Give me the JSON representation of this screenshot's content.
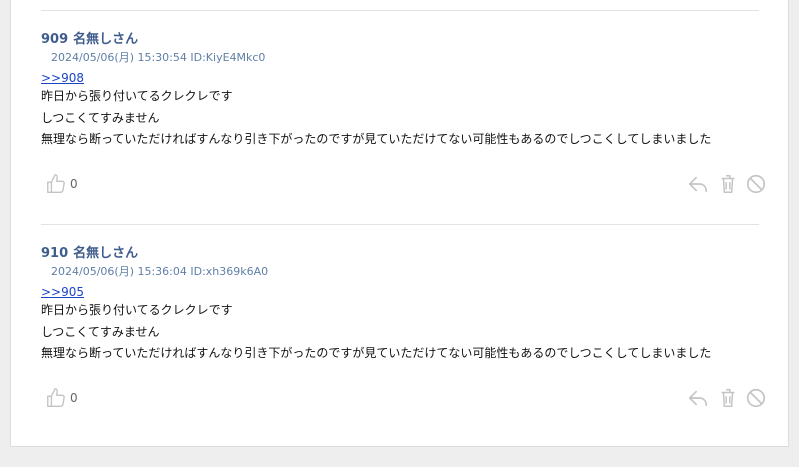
{
  "posts": [
    {
      "number": "909",
      "name": "名無しさん",
      "meta": "2024/05/06(月) 15:30:54 ID:KiyE4Mkc0",
      "anchor": ">>908",
      "lines": [
        "昨日から張り付いてるクレクレです",
        "しつこくてすみません",
        "無理なら断っていただければすんなり引き下がったのですが見ていただけてない可能性もあるのでしつこくしてしまいました"
      ],
      "likes": "0"
    },
    {
      "number": "910",
      "name": "名無しさん",
      "meta": "2024/05/06(月) 15:36:04 ID:xh369k6A0",
      "anchor": ">>905",
      "lines": [
        "昨日から張り付いてるクレクレです",
        "しつこくてすみません",
        "無理なら断っていただければすんなり引き下がったのですが見ていただけてない可能性もあるのでしつこくしてしまいました"
      ],
      "likes": "0"
    }
  ],
  "icons": {
    "like": "thumbs-up-icon",
    "reply": "reply-icon",
    "delete": "trash-icon",
    "report": "ban-icon"
  },
  "colors": {
    "name": "#3f5d8c",
    "meta": "#5f7fa6",
    "anchor": "#1a44c6",
    "icon": "#c4c4c4"
  }
}
